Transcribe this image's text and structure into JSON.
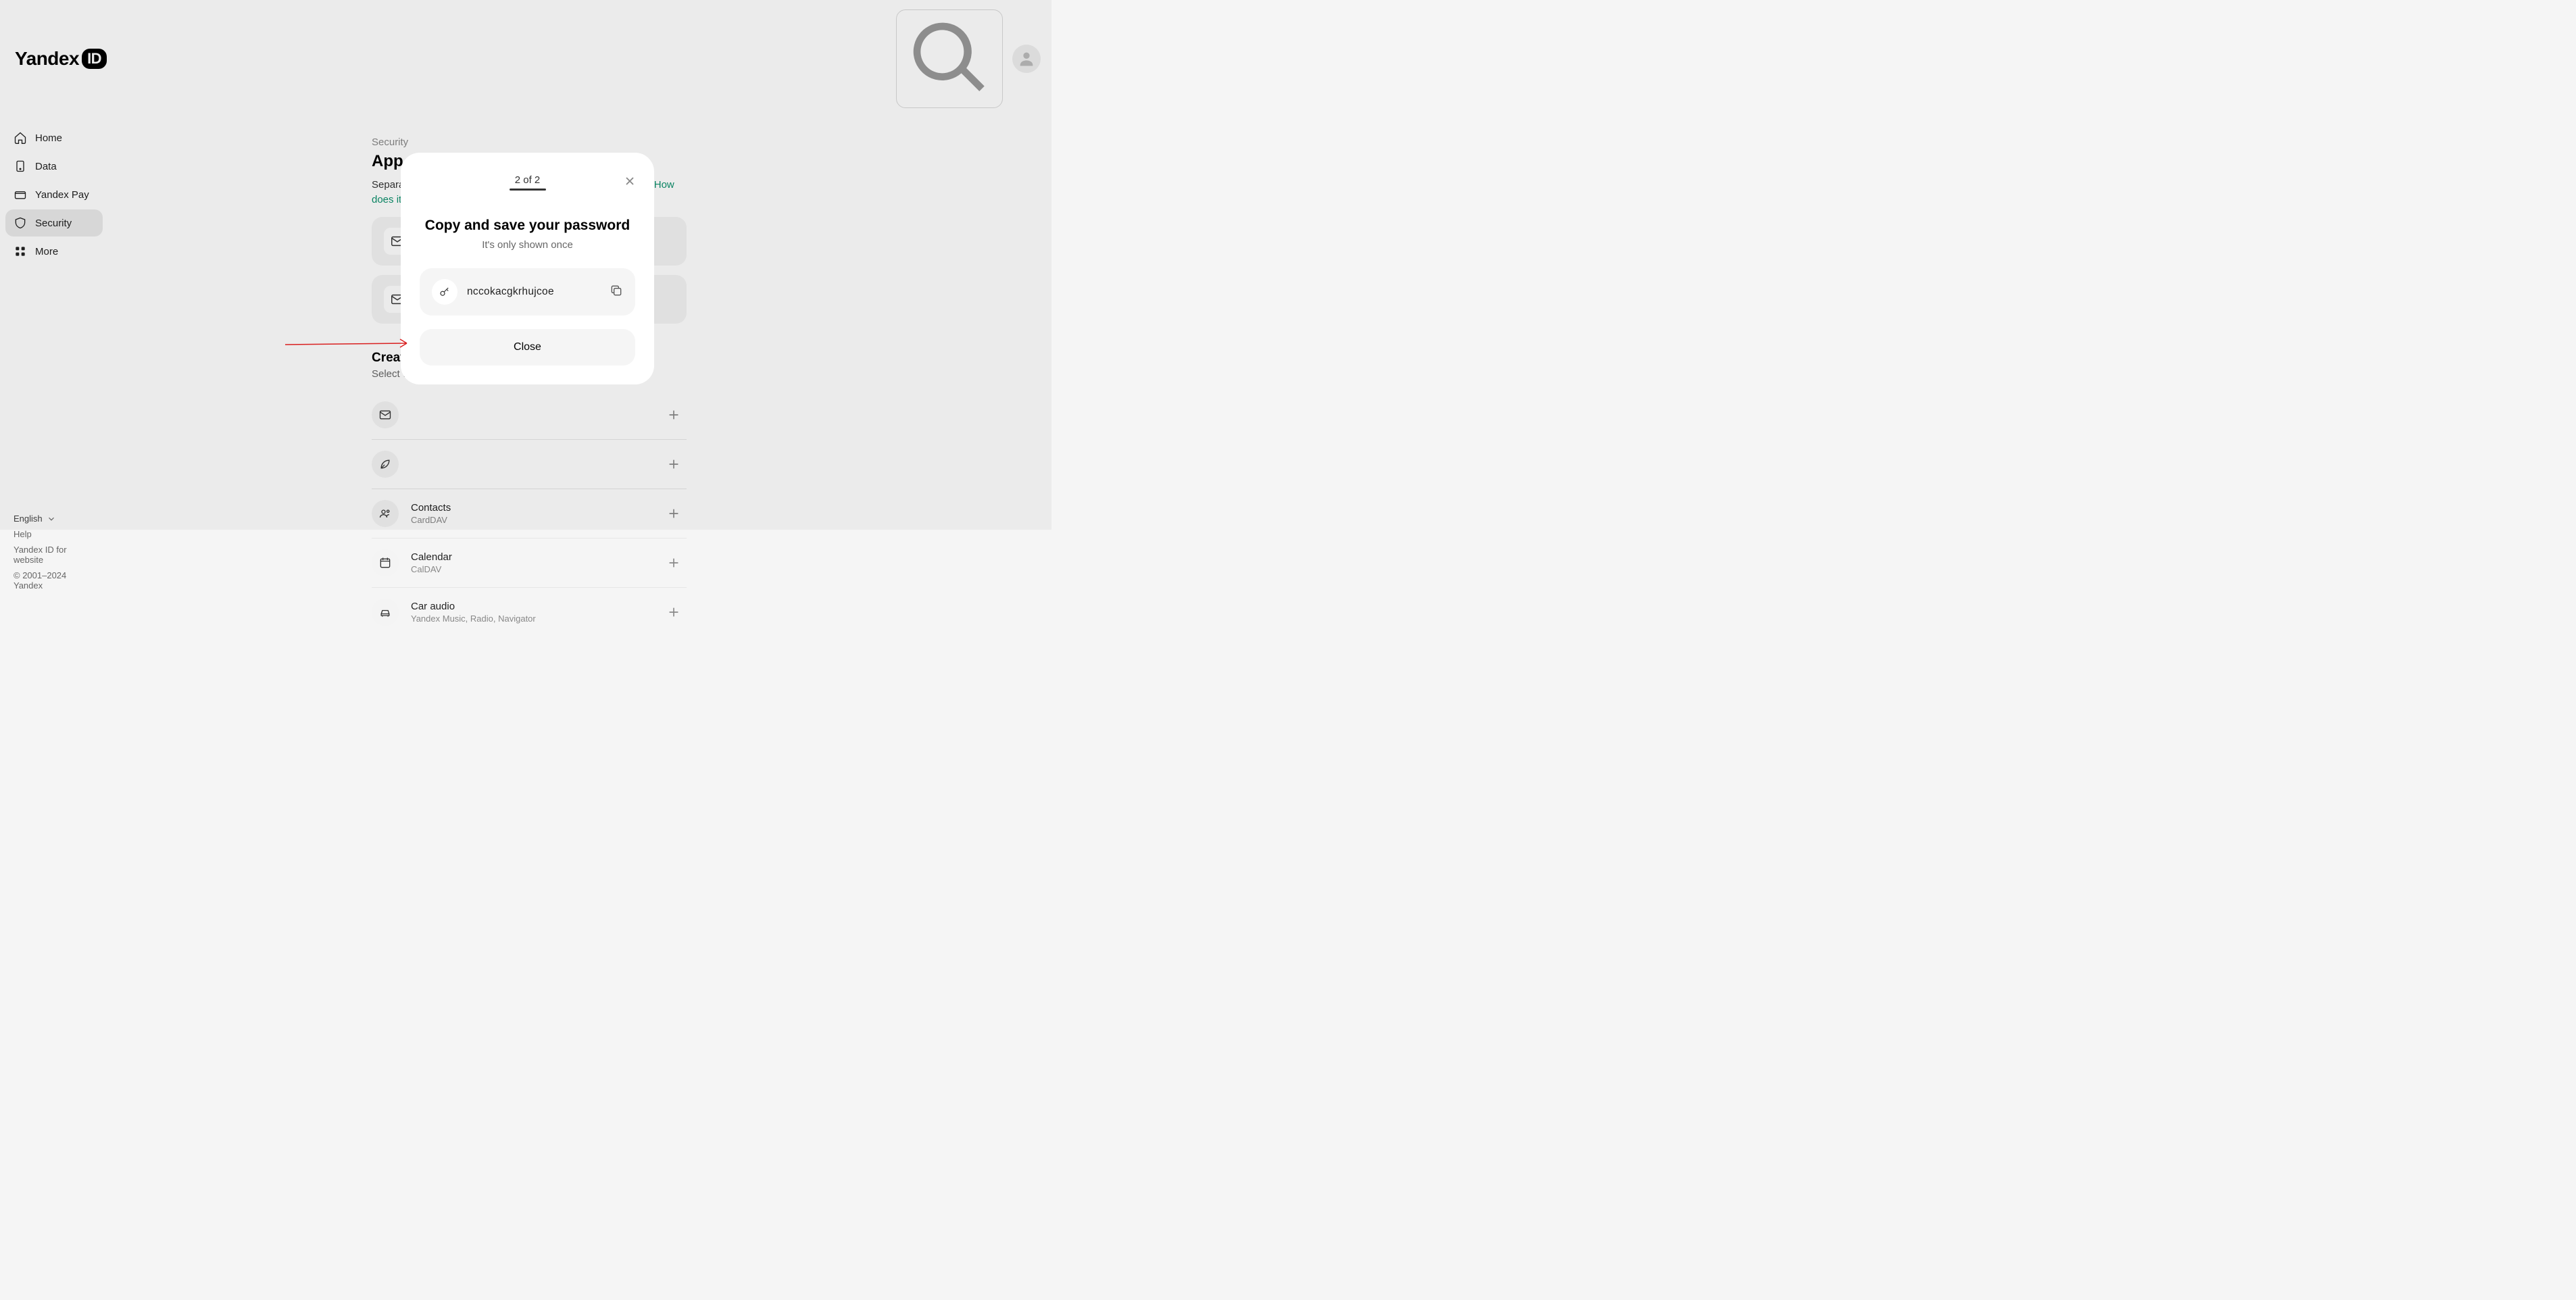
{
  "logo": {
    "brand": "Yandex",
    "suffix": "ID"
  },
  "search": {
    "placeholder": "Search"
  },
  "sidebar": {
    "items": [
      {
        "label": "Home"
      },
      {
        "label": "Data"
      },
      {
        "label": "Yandex Pay"
      },
      {
        "label": "Security"
      },
      {
        "label": "More"
      }
    ],
    "language": "English",
    "help": "Help",
    "idlink": "Yandex ID for website",
    "copyright": "© 2001–2024 Yandex"
  },
  "page": {
    "crumb": "Security",
    "title": "App passwords",
    "desc_text": "Separate passwords that only grant access to necessary data. ",
    "desc_link": "How does it work?"
  },
  "create": {
    "title_partial": "Creat",
    "sub_partial": "Select w",
    "rows": [
      {
        "title": "",
        "sub": ""
      },
      {
        "title": "",
        "sub": ""
      },
      {
        "title": "Contacts",
        "sub": "CardDAV"
      },
      {
        "title": "Calendar",
        "sub": "CalDAV"
      },
      {
        "title": "Car audio",
        "sub": "Yandex Music, Radio, Navigator"
      }
    ]
  },
  "modal": {
    "step": "2 of 2",
    "title": "Copy and save your password",
    "sub": "It's only shown once",
    "password": "nccokacgkrhujcoe",
    "close_label": "Close"
  }
}
